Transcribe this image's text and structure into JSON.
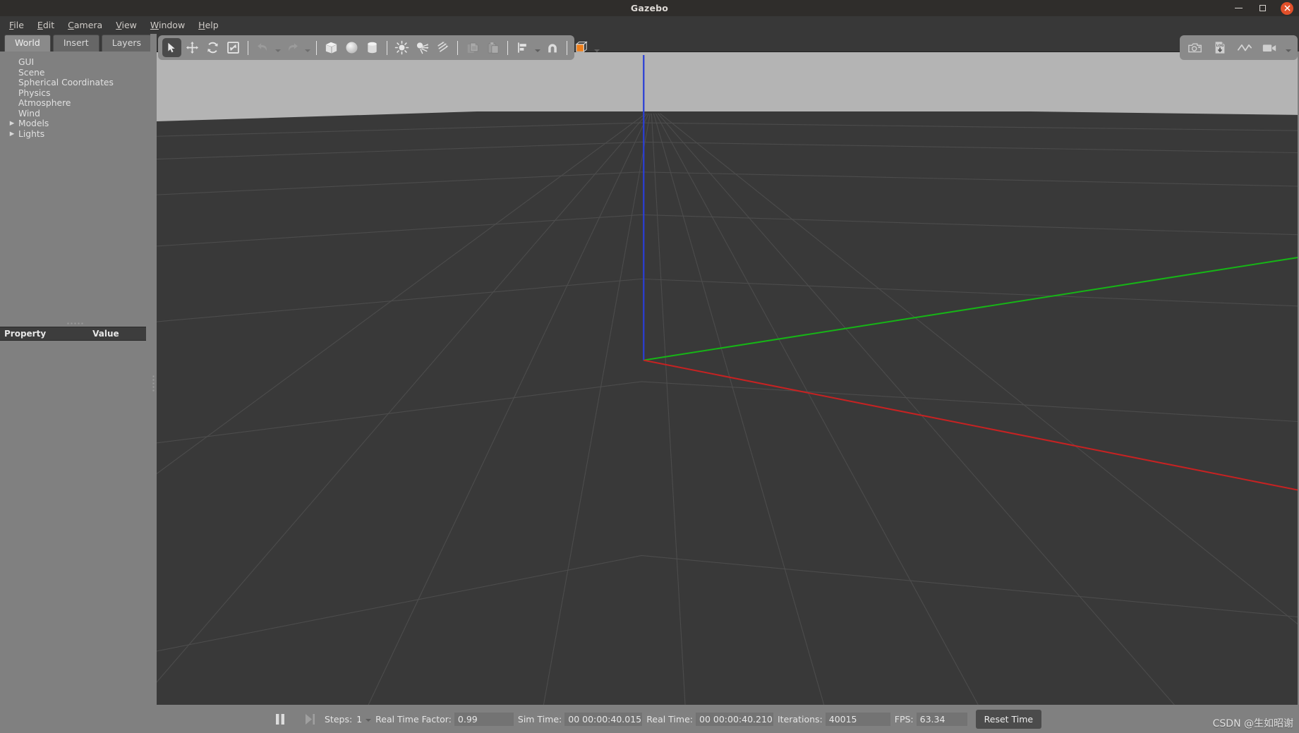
{
  "window": {
    "title": "Gazebo",
    "controls": [
      {
        "name": "minimize",
        "glyph": "minimize-icon"
      },
      {
        "name": "maximize",
        "glyph": "maximize-icon"
      },
      {
        "name": "close",
        "glyph": "close-icon"
      }
    ]
  },
  "menubar": {
    "items": [
      {
        "label": "File",
        "accel": "F"
      },
      {
        "label": "Edit",
        "accel": "E"
      },
      {
        "label": "Camera",
        "accel": "C"
      },
      {
        "label": "View",
        "accel": "V"
      },
      {
        "label": "Window",
        "accel": "W"
      },
      {
        "label": "Help",
        "accel": "H"
      }
    ]
  },
  "left_panel": {
    "tabs": [
      {
        "label": "World",
        "active": true
      },
      {
        "label": "Insert",
        "active": false
      },
      {
        "label": "Layers",
        "active": false
      }
    ],
    "tree": [
      {
        "label": "GUI",
        "expandable": false
      },
      {
        "label": "Scene",
        "expandable": false
      },
      {
        "label": "Spherical Coordinates",
        "expandable": false
      },
      {
        "label": "Physics",
        "expandable": false
      },
      {
        "label": "Atmosphere",
        "expandable": false
      },
      {
        "label": "Wind",
        "expandable": false
      },
      {
        "label": "Models",
        "expandable": true
      },
      {
        "label": "Lights",
        "expandable": true
      }
    ],
    "property_table": {
      "columns": [
        "Property",
        "Value"
      ],
      "rows": []
    }
  },
  "toolbar": {
    "left_group": [
      {
        "name": "select-icon",
        "active": true
      },
      {
        "name": "translate-icon",
        "active": false
      },
      {
        "name": "rotate-icon",
        "active": false
      },
      {
        "name": "scale-icon",
        "active": false
      },
      {
        "name": "undo-icon",
        "active": false,
        "disabled": true
      },
      {
        "name": "redo-icon",
        "active": false,
        "disabled": true
      },
      {
        "name": "box-icon",
        "active": false
      },
      {
        "name": "sphere-icon",
        "active": false
      },
      {
        "name": "cylinder-icon",
        "active": false
      },
      {
        "name": "point-light-icon",
        "active": false
      },
      {
        "name": "spot-light-icon",
        "active": false
      },
      {
        "name": "directional-light-icon",
        "active": false
      },
      {
        "name": "copy-icon",
        "active": false,
        "disabled": true
      },
      {
        "name": "paste-icon",
        "active": false,
        "disabled": true
      },
      {
        "name": "align-icon",
        "active": false
      },
      {
        "name": "snap-icon",
        "active": false
      },
      {
        "name": "view-angle-icon",
        "active": false,
        "accent": "#ef7f1a"
      }
    ],
    "right_group": [
      {
        "name": "screenshot-icon"
      },
      {
        "name": "log-record-icon"
      },
      {
        "name": "plot-icon"
      },
      {
        "name": "video-record-icon"
      }
    ]
  },
  "viewport": {
    "sky_color": "#b4b4b4",
    "ground_color": "#393939",
    "grid_color": "#4a4a4a",
    "axes": [
      {
        "name": "x-axis",
        "color": "#cc2222"
      },
      {
        "name": "y-axis",
        "color": "#22bb22"
      },
      {
        "name": "z-axis",
        "color": "#2a3ed6"
      }
    ]
  },
  "bottom_bar": {
    "pause_icon": "pause-icon",
    "step_icon": "step-forward-icon",
    "steps_label": "Steps:",
    "steps_value": "1",
    "fields": [
      {
        "label": "Real Time Factor:",
        "value": "0.99",
        "width": "w-rtf"
      },
      {
        "label": "Sim Time:",
        "value": "00 00:00:40.015",
        "width": "w-sim"
      },
      {
        "label": "Real Time:",
        "value": "00 00:00:40.210",
        "width": "w-real"
      },
      {
        "label": "Iterations:",
        "value": "40015",
        "width": "w-iter"
      },
      {
        "label": "FPS:",
        "value": "63.34",
        "width": "w-fps"
      }
    ],
    "reset_button": "Reset Time"
  },
  "watermark": "CSDN @生如昭谢"
}
